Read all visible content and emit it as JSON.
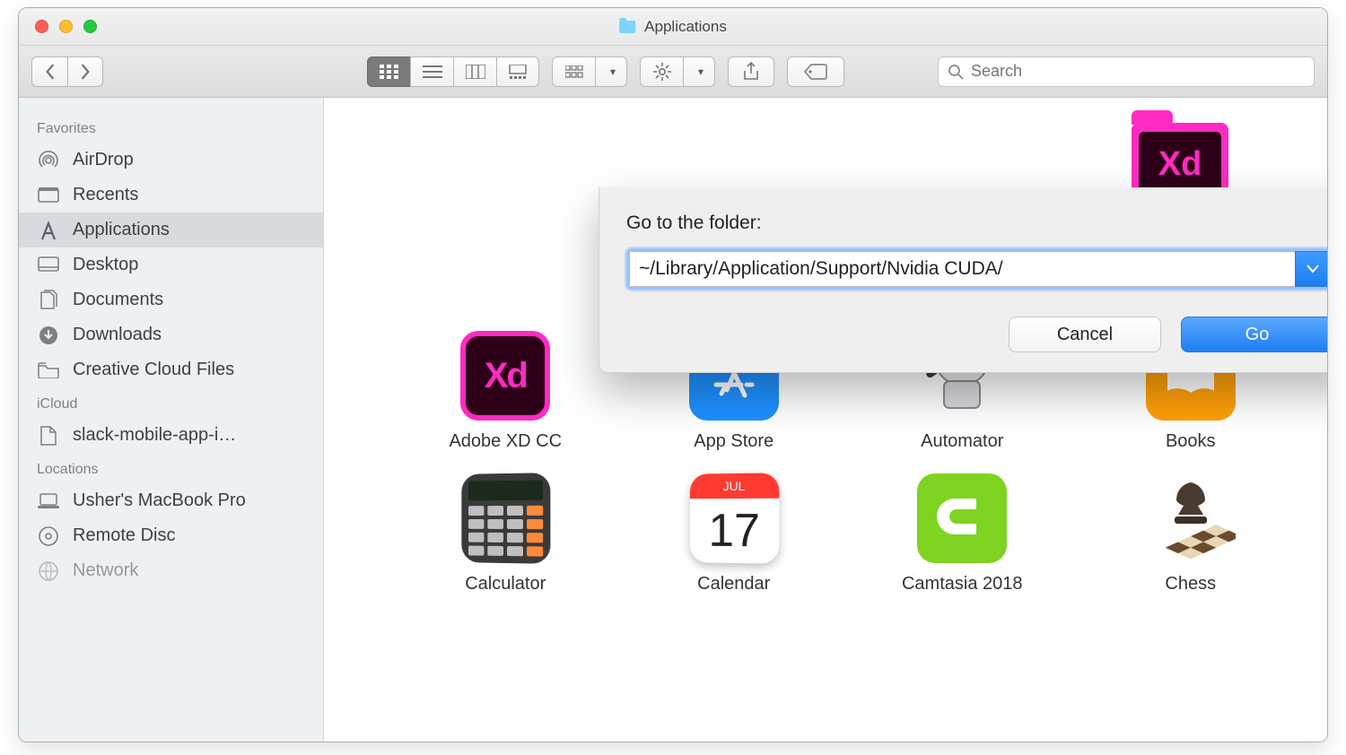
{
  "window": {
    "title": "Applications"
  },
  "toolbar": {
    "search_placeholder": "Search"
  },
  "sidebar": {
    "sections": [
      {
        "title": "Favorites",
        "items": [
          {
            "label": "AirDrop",
            "icon": "airdrop"
          },
          {
            "label": "Recents",
            "icon": "recents"
          },
          {
            "label": "Applications",
            "icon": "apps",
            "selected": true
          },
          {
            "label": "Desktop",
            "icon": "desktop"
          },
          {
            "label": "Documents",
            "icon": "documents"
          },
          {
            "label": "Downloads",
            "icon": "downloads"
          },
          {
            "label": "Creative Cloud Files",
            "icon": "folder"
          }
        ]
      },
      {
        "title": "iCloud",
        "items": [
          {
            "label": "slack-mobile-app-i…",
            "icon": "file"
          }
        ]
      },
      {
        "title": "Locations",
        "items": [
          {
            "label": "Usher's MacBook Pro",
            "icon": "laptop"
          },
          {
            "label": "Remote Disc",
            "icon": "disc"
          },
          {
            "label": "Network",
            "icon": "network"
          }
        ]
      }
    ]
  },
  "dialog": {
    "label": "Go to the folder:",
    "path": "~/Library/Application/Support/Nvidia CUDA/",
    "cancel": "Cancel",
    "go": "Go"
  },
  "apps": {
    "row1": [
      {
        "label": "Adobe XD"
      }
    ],
    "row2": [
      {
        "label": "Adobe XD CC"
      },
      {
        "label": "App Store"
      },
      {
        "label": "Automator"
      },
      {
        "label": "Books"
      }
    ],
    "row3": [
      {
        "label": "Calculator"
      },
      {
        "label": "Calendar",
        "month": "JUL",
        "day": "17"
      },
      {
        "label": "Camtasia 2018"
      },
      {
        "label": "Chess"
      }
    ]
  }
}
